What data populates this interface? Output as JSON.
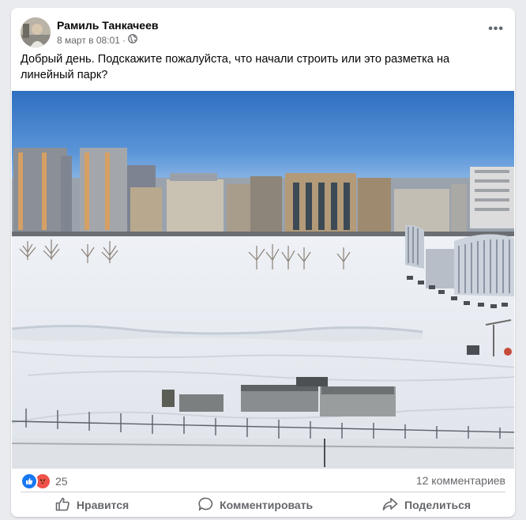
{
  "post": {
    "author": "Рамиль Танкачеев",
    "date": "8 март в 08:01",
    "separator": "·",
    "text": "Добрый день. Подскажите пожалуйста, что начали строить или это разметка на линейный парк?",
    "photo_alt": "Фото"
  },
  "stats": {
    "reactions_count": "25",
    "comments_count": "12 комментариев"
  },
  "actions": {
    "like": "Нравится",
    "comment": "Комментировать",
    "share": "Поделиться"
  },
  "colors": {
    "accent": "#1877f2",
    "angry": "#f0524b",
    "secondary_text": "#65676b"
  },
  "icons": {
    "more": "more-options-icon",
    "privacy": "globe-icon",
    "like": "thumbs-up-icon",
    "comment": "comment-bubble-icon",
    "share": "share-arrow-icon"
  }
}
